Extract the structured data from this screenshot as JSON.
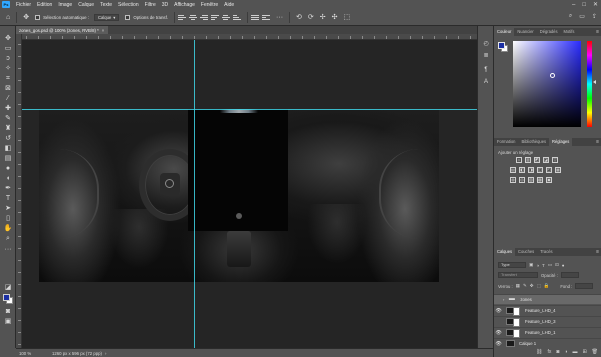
{
  "menu": {
    "logo": "Ps",
    "items": [
      "Fichier",
      "Edition",
      "Image",
      "Calque",
      "Texte",
      "Sélection",
      "Filtre",
      "3D",
      "Affichage",
      "Fenêtre",
      "Aide"
    ],
    "window_controls": {
      "minimize": "–",
      "maximize": "□",
      "close": "✕"
    }
  },
  "options": {
    "home_icon": "⌂",
    "move_icon": "✥",
    "auto_select_label": "Sélection automatique :",
    "auto_select_value": "Calque",
    "transform_label": "Options de transf.",
    "right_icons": {
      "search": "⌕",
      "workspace": "▭",
      "share": "⇪"
    }
  },
  "document": {
    "tab_title": "zones_gos.psd @ 100% (zones, RVB/8) *",
    "close": "×"
  },
  "statusbar": {
    "zoom": "100 %",
    "dimensions": "1260 px x 596 px (72 ppp)",
    "chevron": "›"
  },
  "panels": {
    "color_tabs": [
      "Couleur",
      "Nuancier",
      "Dégradés",
      "Motifs"
    ],
    "adj_tabs": [
      "Formation",
      "Bibliothèques",
      "Réglages"
    ],
    "adj_title": "Ajouter un réglage",
    "adj_icons": [
      [
        "☼",
        "▥",
        "◩",
        "◪",
        "▽"
      ],
      [
        "▤",
        "◧",
        "◨",
        "◫",
        "◰",
        "▦"
      ],
      [
        "◍",
        "◎",
        "▨",
        "▩",
        "▣"
      ]
    ],
    "layer_tabs": [
      "Calques",
      "Couches",
      "Tracés"
    ],
    "filter_value": "Type",
    "mode_value": "Transfert",
    "opacity_label": "Opacité :",
    "fill_label": "Fond :",
    "lock_label": "Verrou :",
    "layers": [
      {
        "name": "zones",
        "type": "folder",
        "visible": false,
        "selected": true
      },
      {
        "name": "Feature_LHD_4",
        "type": "mask",
        "visible": true,
        "selected": false
      },
      {
        "name": "Feature_LHD_3",
        "type": "mask",
        "visible": false,
        "selected": false
      },
      {
        "name": "Feature_LHD_1",
        "type": "mask",
        "visible": true,
        "selected": false
      },
      {
        "name": "Calque 1",
        "type": "image",
        "visible": true,
        "selected": false
      }
    ],
    "menu_glyph": "≡"
  },
  "colors": {
    "foreground": "#1b2fa3",
    "background": "#ffffff",
    "guide": "#3fd5e6",
    "ui_bg": "#535353"
  }
}
